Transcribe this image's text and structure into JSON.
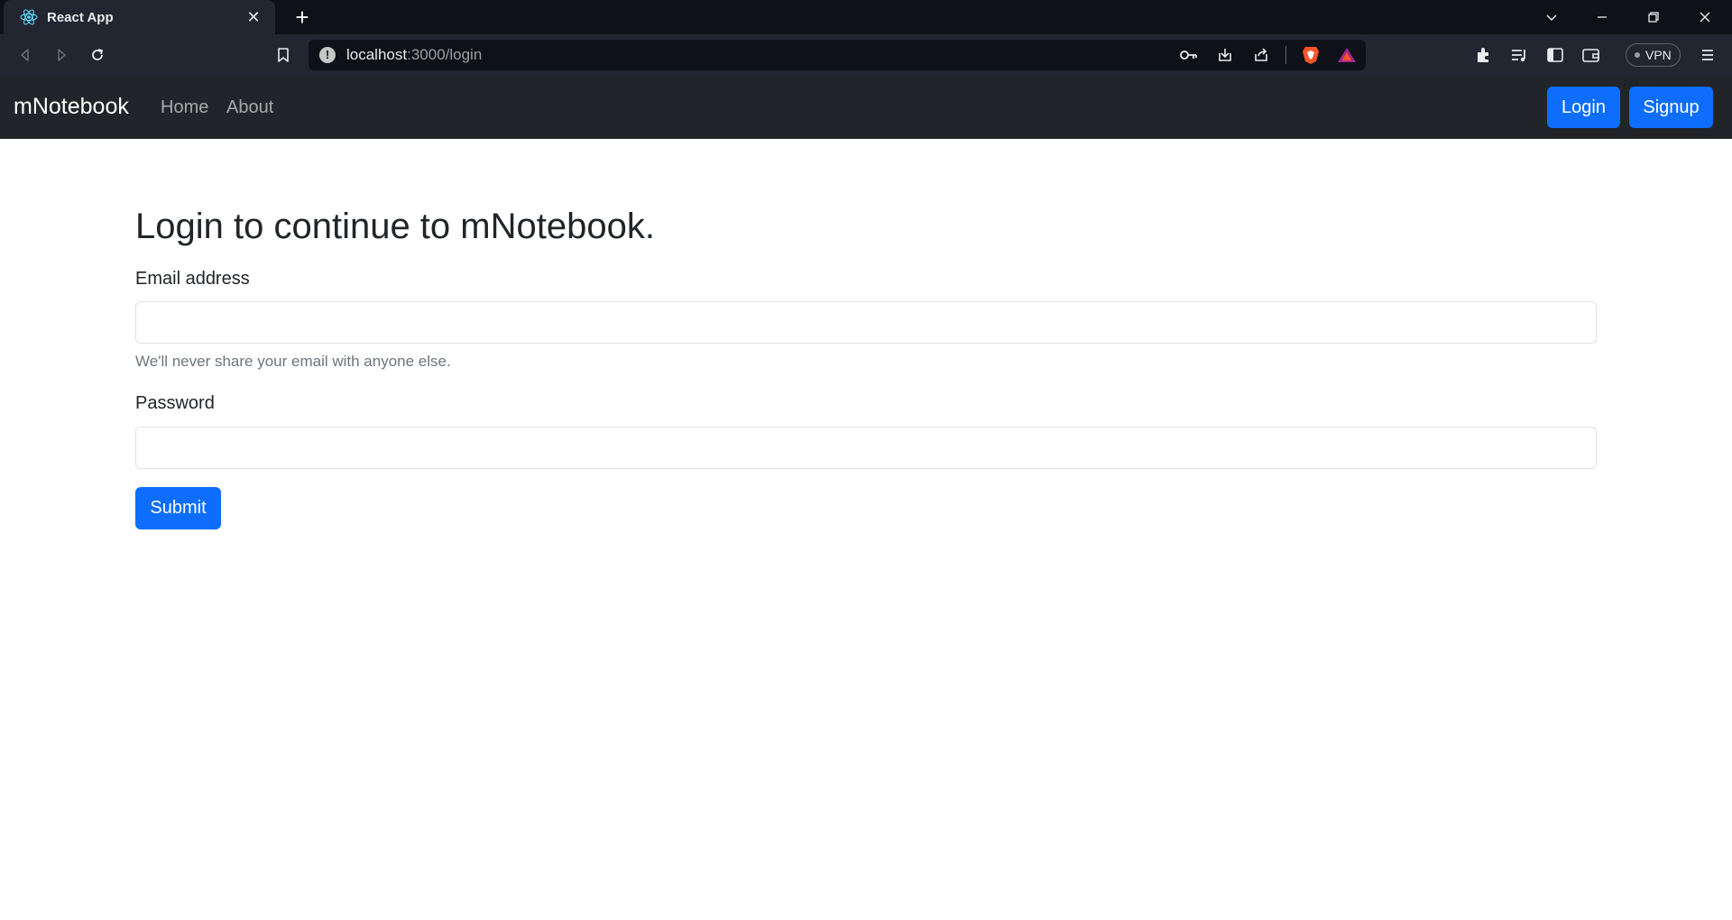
{
  "browser": {
    "tab_title": "React App",
    "url_host": "localhost",
    "url_path": ":3000/login",
    "vpn_label": "VPN"
  },
  "navbar": {
    "brand": "mNotebook",
    "links": [
      "Home",
      "About"
    ],
    "login_label": "Login",
    "signup_label": "Signup"
  },
  "form": {
    "heading": "Login to continue to mNotebook.",
    "email_label": "Email address",
    "email_value": "",
    "email_help": "We'll never share your email with anyone else.",
    "password_label": "Password",
    "password_value": "",
    "submit_label": "Submit"
  },
  "colors": {
    "primary": "#0d6efd",
    "navbar_bg": "#212529",
    "chrome_bg": "#222631",
    "tabstrip_bg": "#0e1117"
  }
}
